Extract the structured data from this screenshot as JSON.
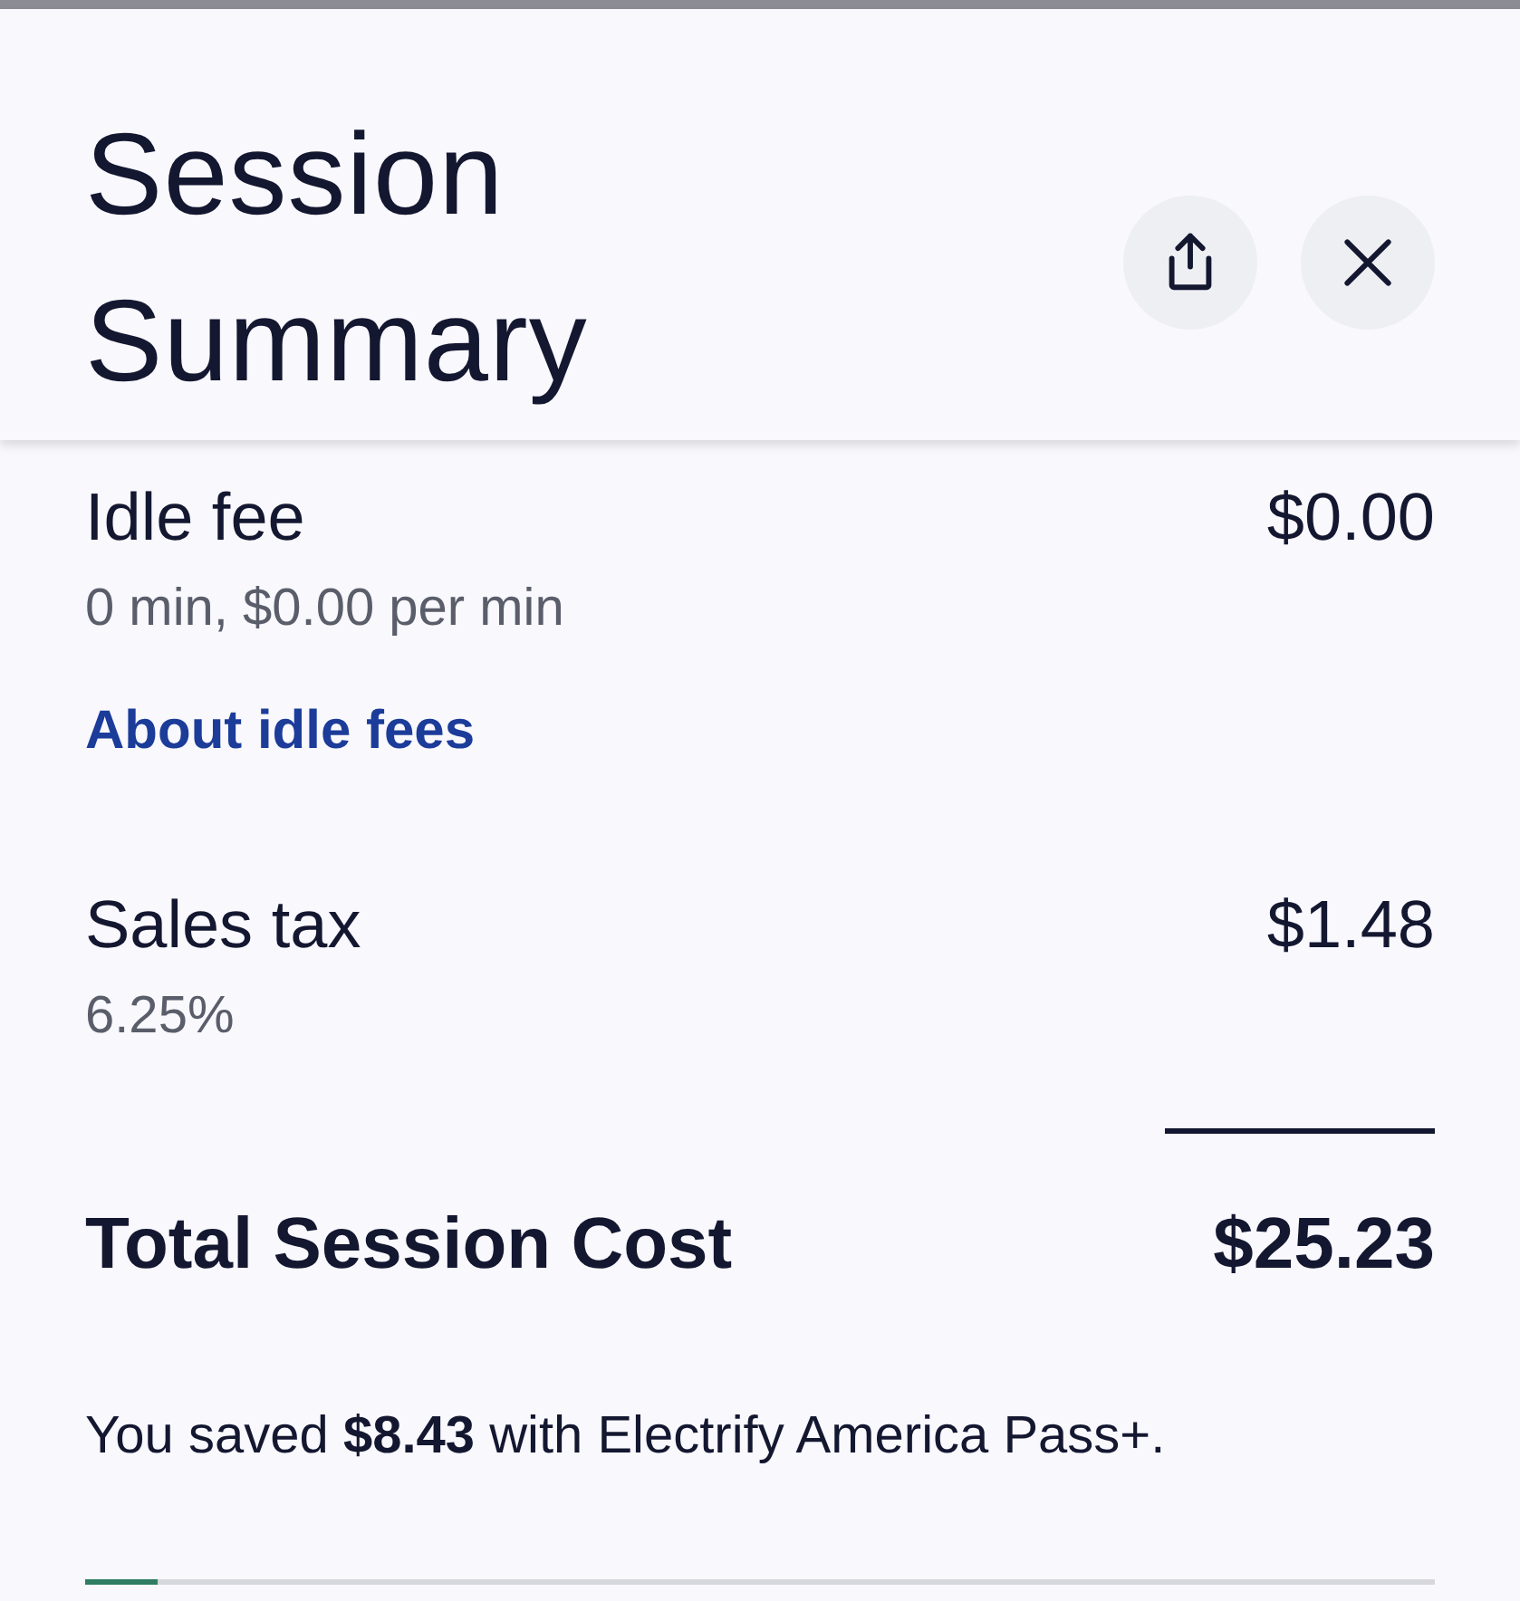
{
  "header": {
    "title": "Session Summary",
    "buttons": [
      {
        "kind": "share"
      },
      {
        "kind": "close"
      }
    ]
  },
  "line_items": [
    {
      "label": "Idle fee",
      "amount": "$0.00",
      "detail": "0 min, $0.00 per min",
      "link": "About idle fees"
    },
    {
      "label": "Sales tax",
      "amount": "$1.48",
      "detail": "6.25%"
    }
  ],
  "total": {
    "label": "Total Session Cost",
    "amount": "$25.23"
  },
  "savings_note": "You saved **$8.43** with Electrify America Pass+.",
  "progress": {
    "level": 0.054
  }
}
